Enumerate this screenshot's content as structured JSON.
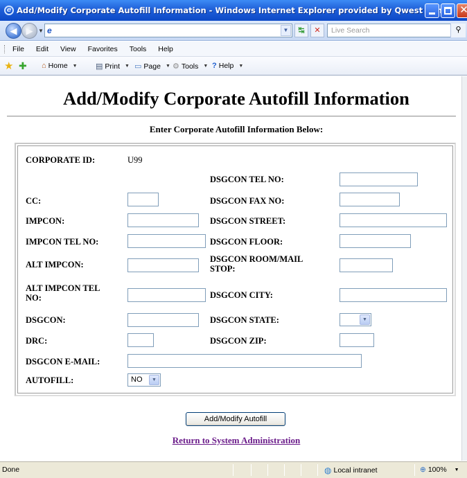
{
  "window": {
    "title": "Add/Modify Corporate Autofill Information - Windows Internet Explorer provided by Qwest Communications"
  },
  "addressbar": {
    "url": "",
    "search_placeholder": "Live Search"
  },
  "menu": [
    "File",
    "Edit",
    "View",
    "Favorites",
    "Tools",
    "Help"
  ],
  "commandbar": {
    "home": "Home",
    "print": "Print",
    "page": "Page",
    "tools": "Tools",
    "help": "Help"
  },
  "page": {
    "title": "Add/Modify Corporate Autofill Information",
    "subtitle": "Enter Corporate Autofill Information Below:",
    "button_label": "Add/Modify Autofill",
    "return_link": "Return to System Administration"
  },
  "form": {
    "corporate_id_label": "CORPORATE ID:",
    "corporate_id_value": "U99",
    "dsgcon_tel_label": "DSGCON TEL NO:",
    "cc_label": "CC:",
    "dsgcon_fax_label": "DSGCON FAX NO:",
    "impcon_label": "IMPCON:",
    "dsgcon_street_label": "DSGCON STREET:",
    "impcon_tel_label": "IMPCON TEL NO:",
    "dsgcon_floor_label": "DSGCON FLOOR:",
    "alt_impcon_label": "ALT IMPCON:",
    "dsgcon_room_label_1": "DSGCON ROOM/MAIL",
    "dsgcon_room_label_2": "STOP:",
    "alt_impcon_tel_label_1": "ALT IMPCON TEL",
    "alt_impcon_tel_label_2": "NO:",
    "dsgcon_city_label": "DSGCON CITY:",
    "dsgcon_label": "DSGCON:",
    "dsgcon_state_label": "DSGCON STATE:",
    "dsgcon_state_value": "",
    "drc_label": "DRC:",
    "dsgcon_zip_label": "DSGCON ZIP:",
    "dsgcon_email_label": "DSGCON E-MAIL:",
    "autofill_label": "AUTOFILL:",
    "autofill_value": "NO"
  },
  "statusbar": {
    "status": "Done",
    "zone": "Local intranet",
    "zoom": "100%"
  }
}
